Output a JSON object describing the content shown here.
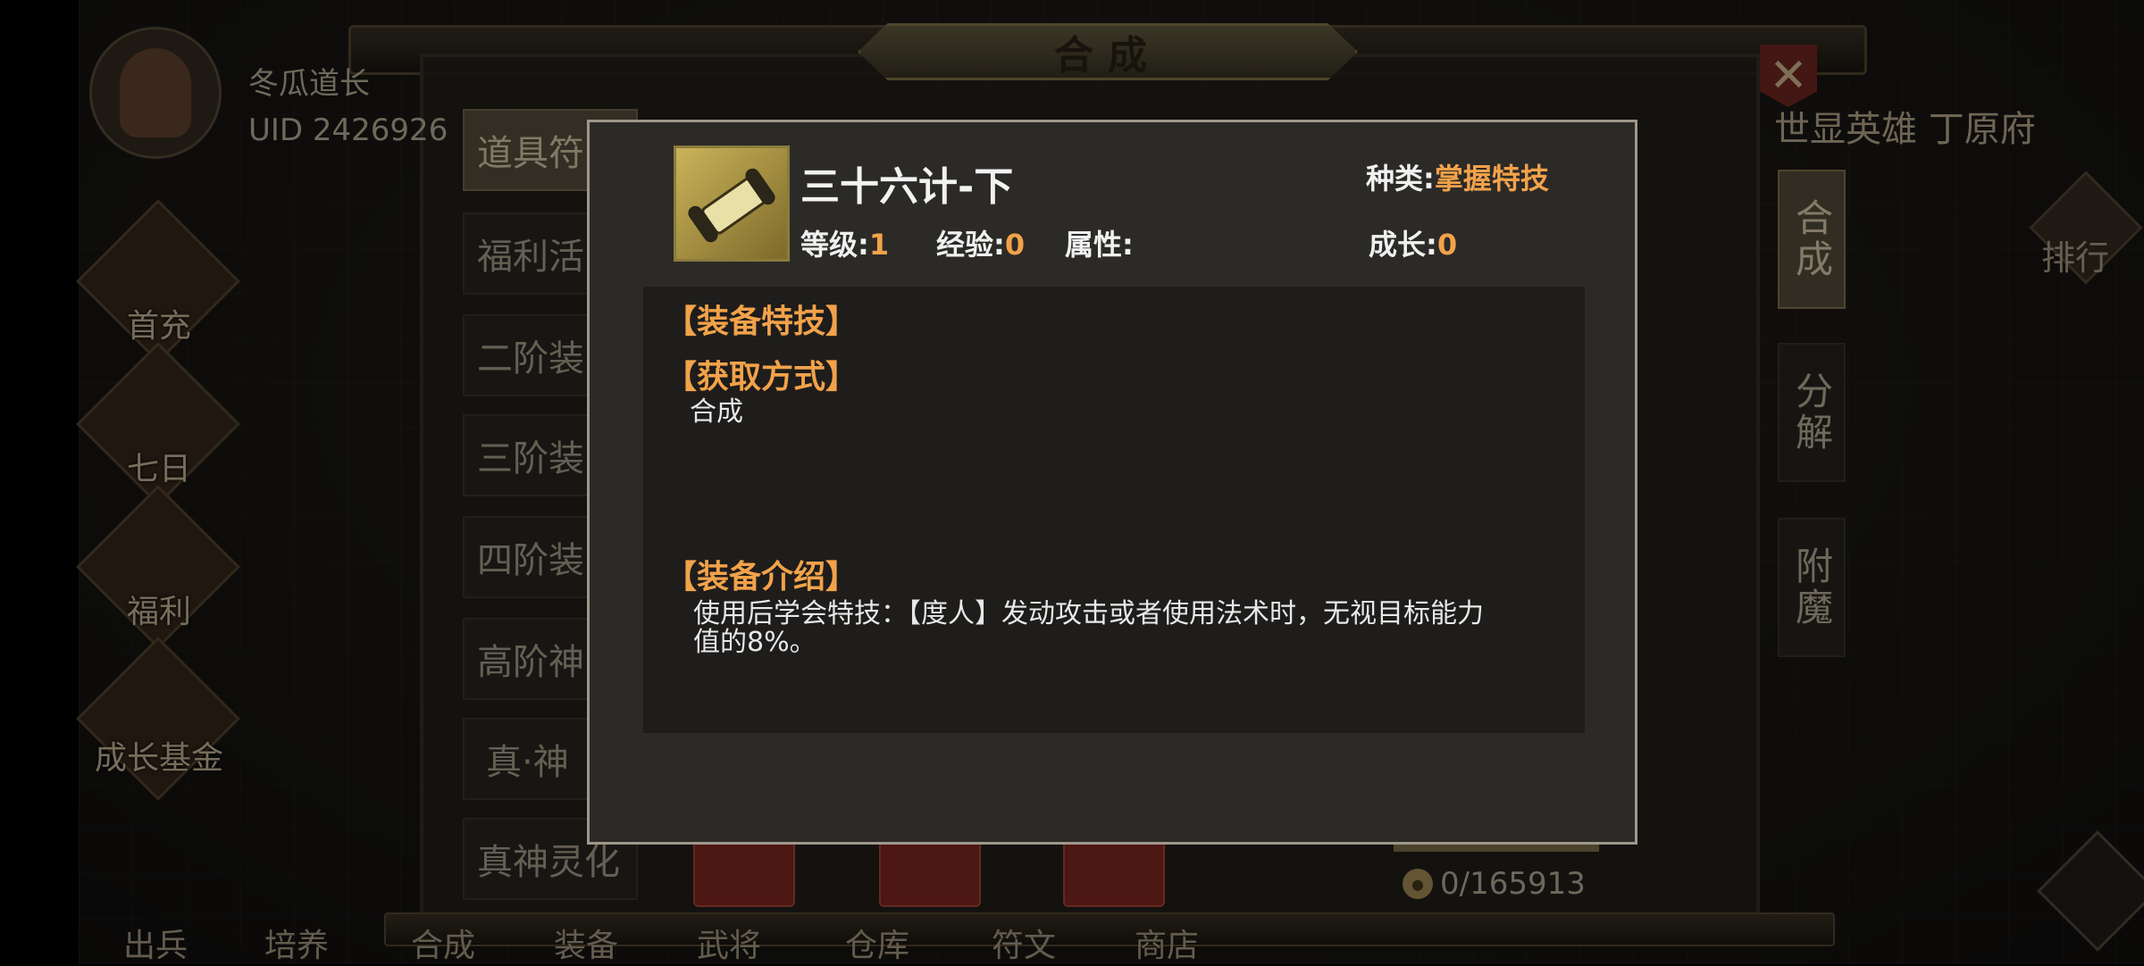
{
  "window": {
    "title": "合成",
    "server": "世显英雄 丁原府"
  },
  "player": {
    "name": "冬瓜道长",
    "uid": "UID 2426926"
  },
  "left_icons": [
    {
      "label": "首充",
      "icon": "first-recharge-icon"
    },
    {
      "label": "七日",
      "icon": "seven-day-icon"
    },
    {
      "label": "福利",
      "icon": "welfare-icon"
    },
    {
      "label": "成长基金",
      "icon": "growth-fund-icon"
    }
  ],
  "categories": [
    {
      "label": "道具符",
      "active": true
    },
    {
      "label": "福利活",
      "active": false
    },
    {
      "label": "二阶装",
      "active": false
    },
    {
      "label": "三阶装",
      "active": false
    },
    {
      "label": "四阶装",
      "active": false
    },
    {
      "label": "高阶神",
      "active": false
    },
    {
      "label": "真·神",
      "active": false
    },
    {
      "label": "真神灵化",
      "active": false
    }
  ],
  "right_tabs": [
    {
      "label": "合成",
      "active": true
    },
    {
      "label": "分解",
      "active": false
    },
    {
      "label": "附魔",
      "active": false
    }
  ],
  "rank_label": "排行",
  "bottom_nav": [
    "出兵",
    "培养",
    "合成",
    "装备",
    "武将",
    "仓库",
    "符文",
    "商店"
  ],
  "currency": {
    "amount": "0/165913"
  },
  "popup": {
    "item_name": "三十六计-下",
    "type_label": "种类:",
    "type_value": "掌握特技",
    "level_label": "等级:",
    "level_value": "1",
    "exp_label": "经验:",
    "exp_value": "0",
    "attr_label": "属性:",
    "attr_value": "",
    "growth_label": "成长:",
    "growth_value": "0",
    "section_skill": "【装备特技】",
    "section_source": "【获取方式】",
    "source_text": "合成",
    "section_intro": "【装备介绍】",
    "intro_text_1": "使用后学会特技：【度人】发动攻击或者使用法术时，无视目标能力",
    "intro_text_2": "值的8%。"
  },
  "colors": {
    "accent": "#f2a24a",
    "popup_bg": "#2c2a27",
    "popup_border": "#9e978a"
  }
}
